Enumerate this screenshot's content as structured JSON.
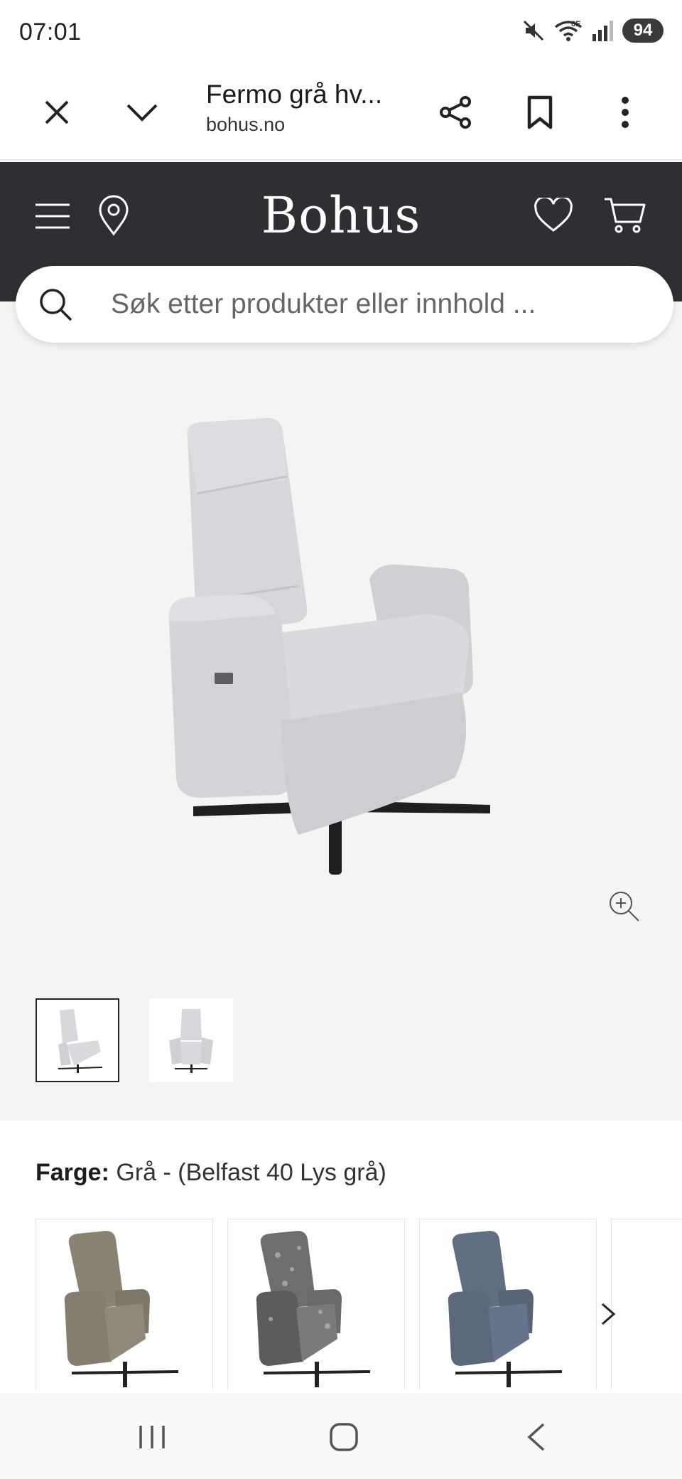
{
  "status_bar": {
    "time": "07:01",
    "battery": "94",
    "network": "6E"
  },
  "browser": {
    "title": "Fermo grå hv...",
    "url": "bohus.no"
  },
  "site": {
    "logo": "Bohus"
  },
  "search": {
    "placeholder": "Søk etter produkter eller innhold ..."
  },
  "product": {
    "color_label": "Farge:",
    "color_value": "Grå - (Belfast 40 Lys grå)",
    "thumbnails": [
      "thumbnail-1",
      "thumbnail-2"
    ],
    "swatches": [
      "olive-brown",
      "grey-sheepskin",
      "blue"
    ]
  },
  "colors": {
    "header_bg": "#2f2f33",
    "gallery_bg": "#f5f4f2",
    "chair_grey": "#d7d8db",
    "chair_olive": "#8a8373",
    "chair_blue": "#5f6e80"
  }
}
